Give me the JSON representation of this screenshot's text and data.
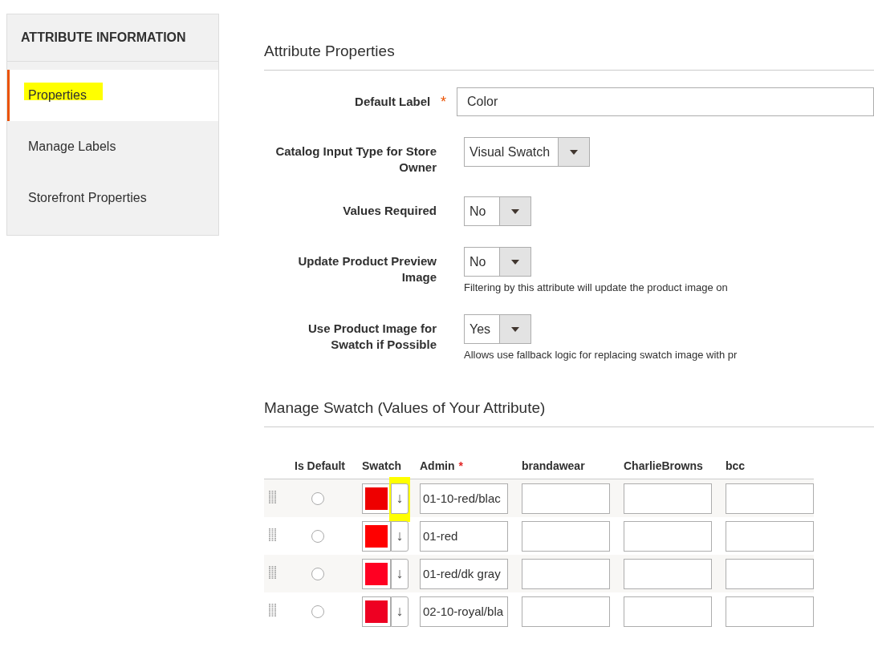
{
  "sidebar": {
    "title": "ATTRIBUTE INFORMATION",
    "items": [
      {
        "label": "Properties",
        "selected": true,
        "highlighted": true
      },
      {
        "label": "Manage Labels",
        "selected": false,
        "highlighted": false
      },
      {
        "label": "Storefront Properties",
        "selected": false,
        "highlighted": false
      }
    ]
  },
  "properties": {
    "title": "Attribute Properties",
    "fields": [
      {
        "kind": "text",
        "label": "Default Label",
        "required_mark": "*",
        "value": "Color"
      },
      {
        "kind": "select",
        "label": "Catalog Input Type for Store Owner",
        "value": "Visual Swatch"
      },
      {
        "kind": "select",
        "label": "Values Required",
        "value": "No"
      },
      {
        "kind": "select",
        "label": "Update Product Preview Image",
        "value": "No",
        "note": "Filtering by this attribute will update the product image on"
      },
      {
        "kind": "select",
        "label": "Use Product Image for Swatch if Possible",
        "value": "Yes",
        "note": "Allows use fallback logic for replacing swatch image with pr"
      }
    ]
  },
  "swatches": {
    "title": "Manage Swatch (Values of Your Attribute)",
    "columns": [
      {
        "label": "Is Default"
      },
      {
        "label": "Swatch"
      },
      {
        "label": "Admin",
        "required_mark": "*"
      },
      {
        "label": "brandawear"
      },
      {
        "label": "CharlieBrowns"
      },
      {
        "label": "bcc"
      }
    ],
    "rows": [
      {
        "is_default": false,
        "color": "#ee0000",
        "arrow": "↓",
        "arrow_highlighted": true,
        "admin": "01-10-red/blac"
      },
      {
        "is_default": false,
        "color": "#ff0000",
        "arrow": "↓",
        "arrow_highlighted": false,
        "admin": "01-red"
      },
      {
        "is_default": false,
        "color": "#ff0022",
        "arrow": "↓",
        "arrow_highlighted": false,
        "admin": "01-red/dk gray"
      },
      {
        "is_default": false,
        "color": "#ee0022",
        "arrow": "↓",
        "arrow_highlighted": false,
        "admin": "02-10-royal/bla"
      }
    ]
  }
}
